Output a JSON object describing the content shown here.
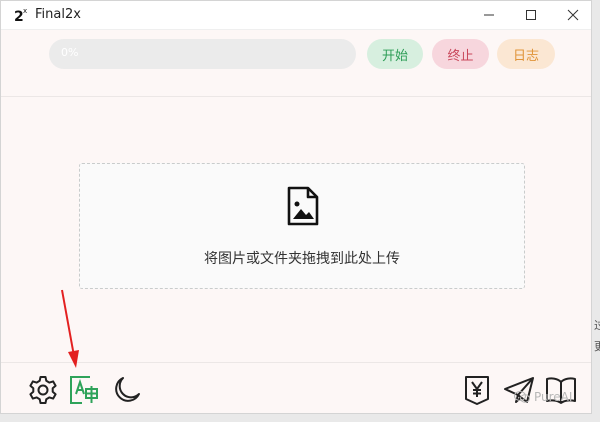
{
  "window": {
    "title": "Final2x",
    "controls": [
      "minimize-icon",
      "maximize-icon",
      "close-icon"
    ]
  },
  "toolbar": {
    "progress_percent": 0,
    "progress_label": "0%",
    "start_label": "开始",
    "stop_label": "终止",
    "log_label": "日志"
  },
  "dropzone": {
    "icon": "image-file-icon",
    "text": "将图片或文件夹拖拽到此处上传"
  },
  "footer": {
    "left_icons": [
      "settings-gear-icon",
      "language-translate-icon",
      "dark-mode-moon-icon"
    ],
    "right_icons": [
      "donate-yen-icon",
      "telegram-plane-icon",
      "docs-book-icon"
    ]
  },
  "overlay": {
    "watermark": "PureAI",
    "edge_chars": [
      "过",
      "更"
    ]
  },
  "colors": {
    "start_bg": "#d7efdf",
    "start_fg": "#2e9d57",
    "stop_bg": "#f7d6dd",
    "stop_fg": "#c9485b",
    "log_bg": "#fbe7d3",
    "log_fg": "#e0943a",
    "translate_icon": "#2fa35a",
    "annotation_arrow": "#e32020"
  }
}
